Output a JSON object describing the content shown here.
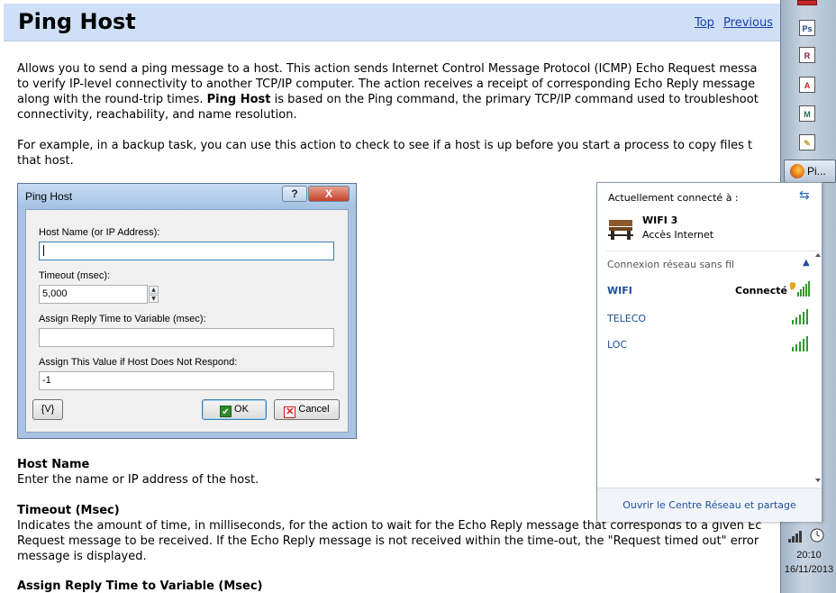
{
  "help": {
    "title": "Ping Host",
    "nav": {
      "top": "Top",
      "previous": "Previous"
    },
    "intro": [
      "Allows you to send a ping message to a host. This action sends Internet Control Message Protocol (ICMP) Echo Request messa",
      "to verify IP-level connectivity to another TCP/IP computer. The action receives a receipt of corresponding Echo Reply message",
      "along with the round-trip times.",
      "Ping Host",
      " is based on the Ping command, the primary TCP/IP command used to troubleshoot",
      "connectivity, reachability, and name resolution."
    ],
    "example": [
      "For example, in a backup task, you can use this action to check to see if a host is up before you start a process to copy files t",
      "that host."
    ],
    "sections": [
      {
        "title": "Host Name",
        "lines": [
          "Enter the name or IP address of the host."
        ]
      },
      {
        "title": "Timeout (Msec)",
        "lines": [
          "Indicates the amount of time, in milliseconds, for the action to wait for the Echo Reply message that corresponds to a given Ec",
          "Request message to be received. If the Echo Reply message is not received within the time-out, the \"Request timed out\" error",
          "message is displayed."
        ]
      },
      {
        "title": "Assign Reply Time to Variable (Msec)",
        "lines": []
      }
    ]
  },
  "dialog": {
    "title": "Ping Host",
    "help_label": "?",
    "close_label": "X",
    "host_label": "Host Name (or IP Address):",
    "host_value": "",
    "timeout_label": "Timeout (msec):",
    "timeout_value": "5,000",
    "assign_label": "Assign Reply Time to Variable (msec):",
    "assign_value": "",
    "noresp_label": "Assign This Value if Host Does Not Respond:",
    "noresp_value": "-1",
    "var_button": "{V}",
    "ok_button": "OK",
    "cancel_button": "Cancel"
  },
  "taskbar": {
    "icons": [
      {
        "name": "adobe-icon",
        "glyph": "Ps",
        "color": "#1c3f86"
      },
      {
        "name": "r-app-icon",
        "glyph": "R",
        "color": "#7b1f3c"
      },
      {
        "name": "acrobat-icon",
        "glyph": "A",
        "color": "#c61f1f"
      },
      {
        "name": "m-app-icon",
        "glyph": "M",
        "color": "#1f6b4a"
      },
      {
        "name": "tools-icon",
        "glyph": "✎",
        "color": "#c49a1f"
      }
    ],
    "task_label": "Pi...",
    "time": "20:10",
    "date": "16/11/2013"
  },
  "network": {
    "connected_label": "Actuellement connecté à :",
    "current_name": "WIFI 3",
    "current_status": "Accès Internet",
    "section_label": "Connexion réseau sans fil",
    "networks": [
      {
        "name": "WIFI",
        "status": "Connecté"
      },
      {
        "name": "TELECO",
        "status": ""
      },
      {
        "name": "LOC",
        "status": ""
      }
    ],
    "footer": "Ouvrir le Centre Réseau et partage"
  },
  "colors": {
    "header_bg": "#cfe0f6",
    "link": "#1a3fb0",
    "net_link": "#1e4f9a",
    "signal": "#2f9a2f"
  }
}
